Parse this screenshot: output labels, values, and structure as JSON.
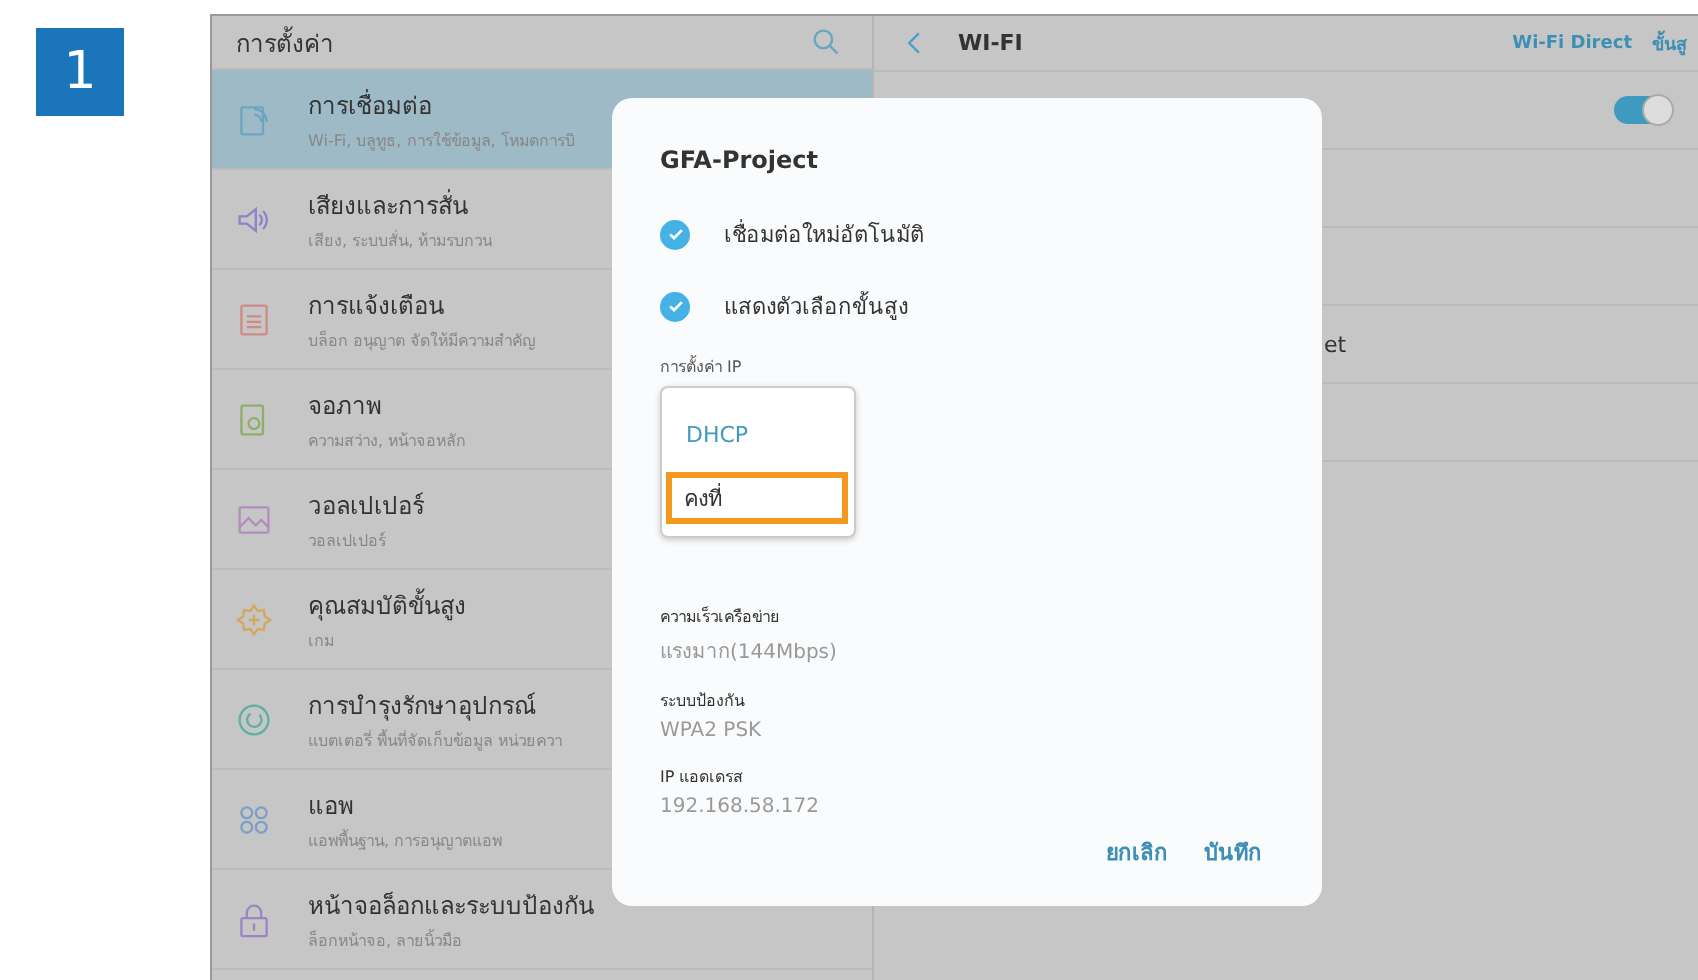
{
  "step_badge": "1",
  "sidebar": {
    "title": "การตั้งค่า",
    "items": [
      {
        "kind": "connection",
        "color": "#6aa6c0",
        "title": "การเชื่อมต่อ",
        "subtitle": "Wi-Fi, บลูทูธ, การใช้ข้อมูล, โหมดการบิ",
        "selected": true
      },
      {
        "kind": "sound",
        "color": "#8a84c8",
        "title": "เสียงและการสั่น",
        "subtitle": "เสียง, ระบบสั่น, ห้ามรบกวน",
        "selected": false
      },
      {
        "kind": "notification",
        "color": "#d08a84",
        "title": "การแจ้งเตือน",
        "subtitle": "บล็อก อนุญาต จัดให้มีความสำคัญ",
        "selected": false
      },
      {
        "kind": "display",
        "color": "#8fae6a",
        "title": "จอภาพ",
        "subtitle": "ความสว่าง, หน้าจอหลัก",
        "selected": false
      },
      {
        "kind": "wallpaper",
        "color": "#b58cc0",
        "title": "วอลเปเปอร์",
        "subtitle": "วอลเปเปอร์",
        "selected": false
      },
      {
        "kind": "advanced",
        "color": "#d0a860",
        "title": "คุณสมบัติขั้นสูง",
        "subtitle": "เกม",
        "selected": false
      },
      {
        "kind": "maintenance",
        "color": "#5eb0a0",
        "title": "การบำรุงรักษาอุปกรณ์",
        "subtitle": "แบตเตอรี่ พื้นที่จัดเก็บข้อมูล หน่วยควา",
        "selected": false
      },
      {
        "kind": "apps",
        "color": "#7aa0c8",
        "title": "แอพ",
        "subtitle": "แอพพื้นฐาน, การอนุญาตแอพ",
        "selected": false
      },
      {
        "kind": "lock",
        "color": "#9a86c4",
        "title": "หน้าจอล็อกและระบบป้องกัน",
        "subtitle": "ล็อกหน้าจอ, ลายนิ้วมือ",
        "selected": false
      }
    ]
  },
  "wifi_panel": {
    "title": "WI-FI",
    "actions": [
      "Wi-Fi Direct",
      "ขั้นสู"
    ],
    "toggle_on": true,
    "row_fragment": "et"
  },
  "dialog": {
    "title": "GFA-Project",
    "options": [
      {
        "label": "เชื่อมต่อใหม่อัตโนมัติ",
        "checked": true
      },
      {
        "label": "แสดงตัวเลือกขั้นสูง",
        "checked": true
      }
    ],
    "ip_settings": {
      "label": "การตั้งค่า IP",
      "choices": [
        {
          "label": "DHCP",
          "selected": true,
          "highlighted": false
        },
        {
          "label": "คงที่",
          "selected": false,
          "highlighted": true
        }
      ]
    },
    "details": [
      {
        "label": "ความเร็วเครือข่าย",
        "value": "แรงมาก(144Mbps)"
      },
      {
        "label": "ระบบป้องกัน",
        "value": "WPA2 PSK"
      },
      {
        "label": "IP แอดเดรส",
        "value": "192.168.58.172"
      }
    ],
    "buttons": [
      "ยกเลิก",
      "บันทึก"
    ]
  }
}
